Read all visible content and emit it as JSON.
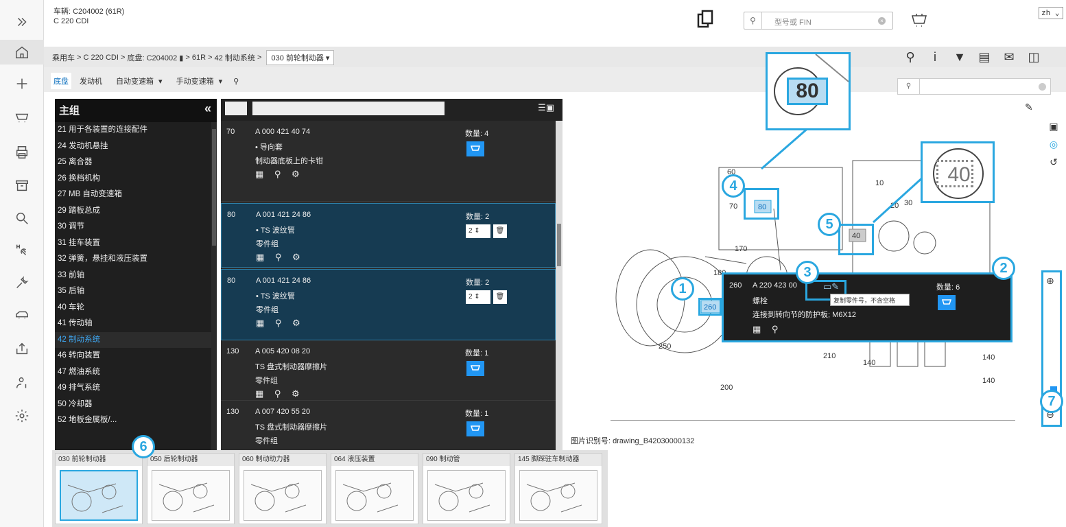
{
  "header": {
    "vehicle_line": "车辆: C204002 (61R)",
    "model_line": "C 220 CDI",
    "search_placeholder": "型号或 FIN",
    "language": "zh"
  },
  "breadcrumb": {
    "items": [
      "乘用车",
      "C 220 CDI",
      "底盘: C204002",
      "61R",
      "42 制动系统"
    ],
    "separator": ">",
    "current": "030 前轮制动器"
  },
  "tabs": [
    "底盘",
    "发动机",
    "自动变速箱",
    "手动变速箱"
  ],
  "main_group": {
    "title": "主组",
    "items": [
      "21 用于各装置的连接配件",
      "24 发动机悬挂",
      "25 离合器",
      "26 换档机构",
      "27 MB 自动变速箱",
      "29 踏板总成",
      "30 调节",
      "31 挂车装置",
      "32 弹簧，悬挂和液压装置",
      "33 前轴",
      "35 后轴",
      "40 车轮",
      "41 传动轴",
      "42 制动系统",
      "46 转向装置",
      "47 燃油系统",
      "49 排气系统",
      "50 冷却器",
      "52 地板金属板/..."
    ],
    "selected": "42 制动系统"
  },
  "parts": {
    "qty_label": "数量:",
    "rows": [
      {
        "pos": "70",
        "pn": "A 000 421 40 74",
        "d1": "• 导向套",
        "d2": "制动器底板上的卡钳",
        "qty": "4"
      },
      {
        "pos": "80",
        "pn": "A 001 421 24 86",
        "d1": "• TS 波纹管",
        "d2": "零件组",
        "qty": "2",
        "stepper": "2"
      },
      {
        "pos": "80",
        "pn": "A 001 421 24 86",
        "d1": "• TS 波纹管",
        "d2": "零件组",
        "qty": "2",
        "stepper": "2"
      },
      {
        "pos": "130",
        "pn": "A 005 420 08 20",
        "d1": "TS 盘式制动器摩擦片",
        "d2": "零件组",
        "qty": "1"
      },
      {
        "pos": "130",
        "pn": "A 007 420 55 20",
        "d1": "TS 盘式制动器摩擦片",
        "d2": "零件组",
        "qty": "1"
      }
    ]
  },
  "popup": {
    "pos": "260",
    "pn": "A 220 423 00",
    "d1": "螺栓",
    "d2": "连接到转向节的防护板; M6X12",
    "qty": "6",
    "tooltip": "复制零件号，不含空格"
  },
  "drawing": {
    "caption": "图片识别号: drawing_B42030000132",
    "labels": [
      "60",
      "70",
      "80",
      "10",
      "20",
      "30",
      "40",
      "170",
      "180",
      "260",
      "250",
      "210",
      "200",
      "140",
      "140",
      "140"
    ],
    "zoom1": "80",
    "zoom2": "40"
  },
  "callouts": [
    "1",
    "2",
    "3",
    "4",
    "5",
    "6",
    "7"
  ],
  "thumbnails": [
    "030 前轮制动器",
    "050 后轮制动器",
    "060 制动助力器",
    "064 液压装置",
    "090 制动管",
    "145 脚踩驻车制动器"
  ],
  "colors": {
    "accent": "#2aa7e0",
    "cart": "#2196f3",
    "dark_panel": "#1f1f1f"
  }
}
